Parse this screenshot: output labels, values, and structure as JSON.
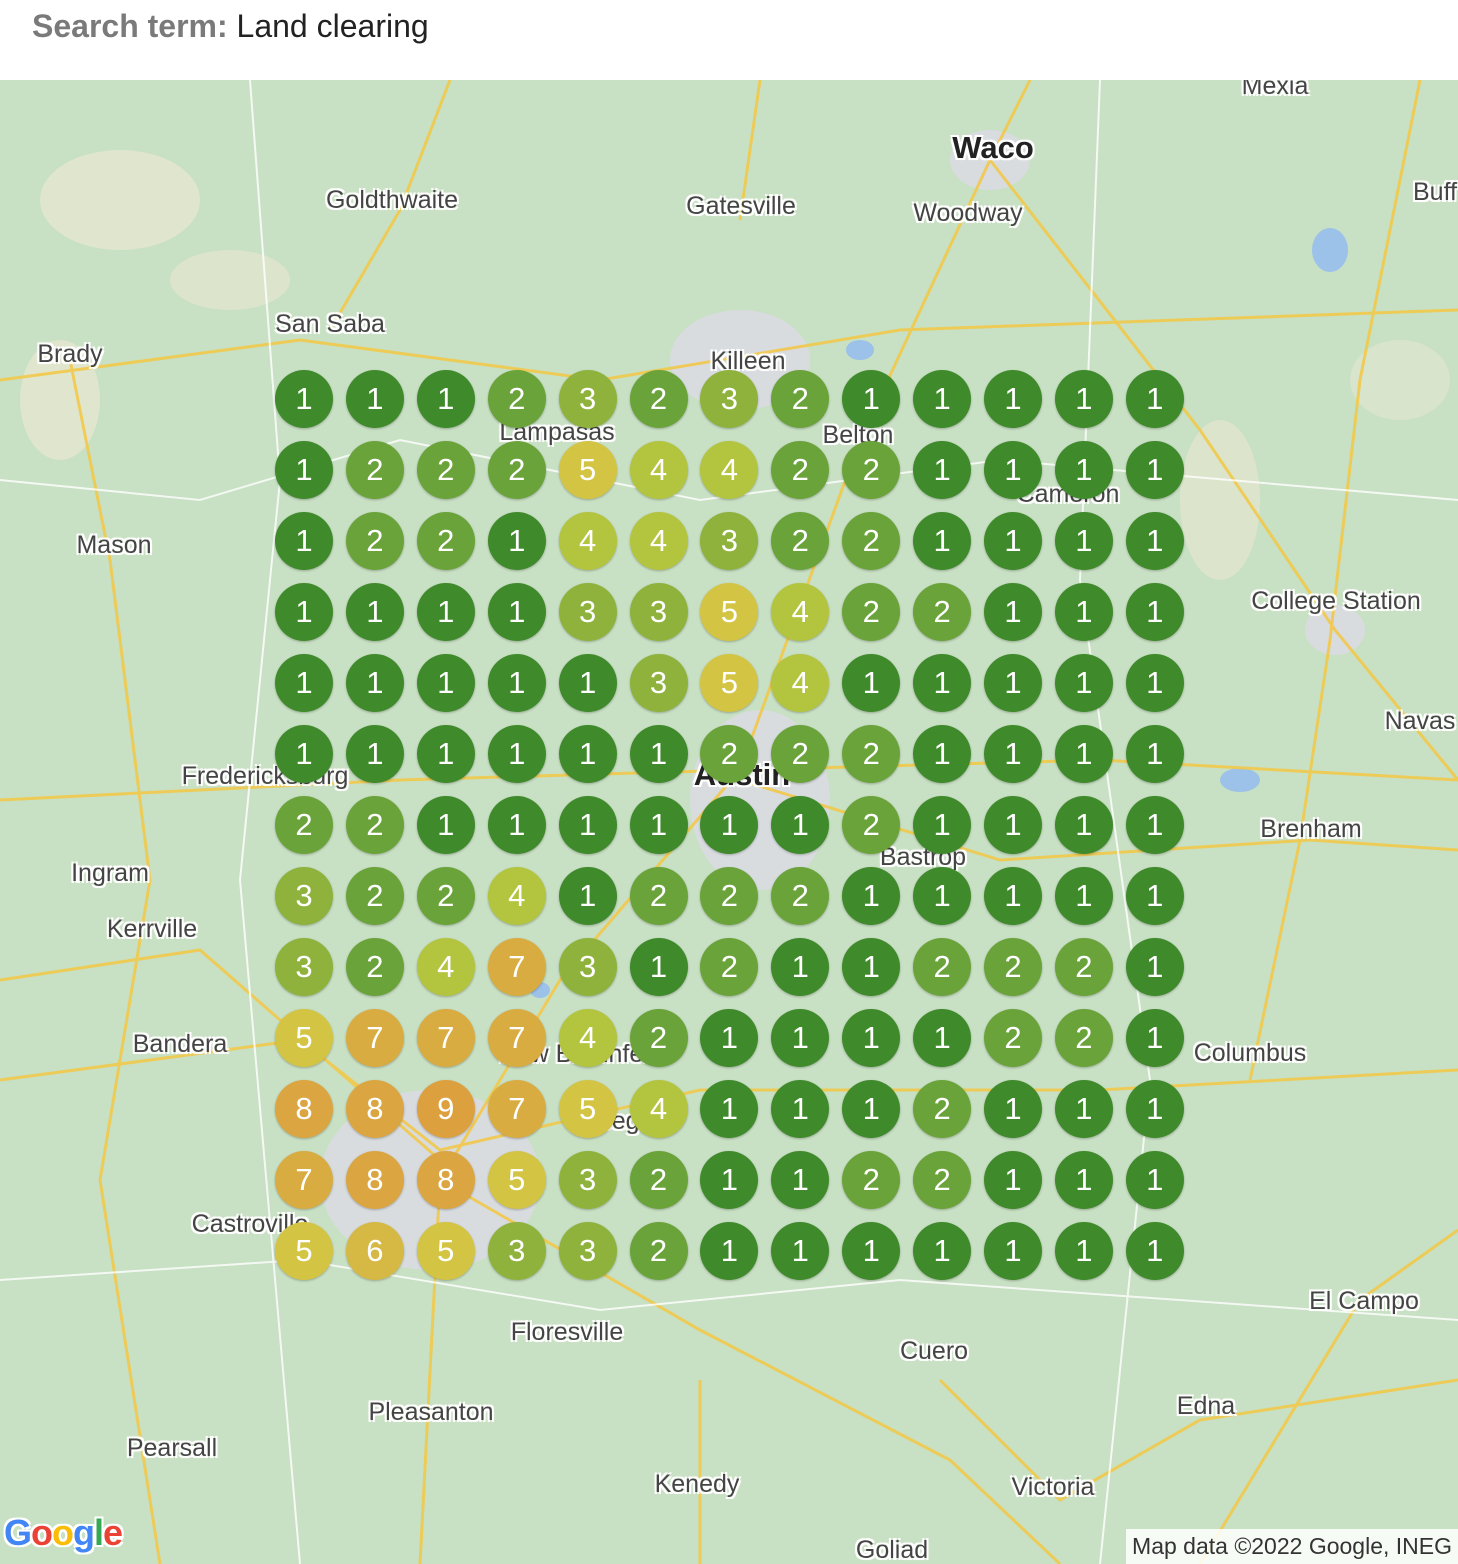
{
  "search": {
    "label": "Search term:",
    "value": "Land clearing"
  },
  "map": {
    "cities": [
      {
        "name": "Waco",
        "big": true
      },
      {
        "name": "Mexia"
      },
      {
        "name": "Goldthwaite"
      },
      {
        "name": "Gatesville"
      },
      {
        "name": "Woodway"
      },
      {
        "name": "San Saba"
      },
      {
        "name": "Brady"
      },
      {
        "name": "Killeen"
      },
      {
        "name": "Lampasas"
      },
      {
        "name": "Belton"
      },
      {
        "name": "Cameron"
      },
      {
        "name": "Mason"
      },
      {
        "name": "College Station"
      },
      {
        "name": "Austin",
        "big": true
      },
      {
        "name": "Fredericksburg"
      },
      {
        "name": "Bastrop"
      },
      {
        "name": "Brenham"
      },
      {
        "name": "Ingram"
      },
      {
        "name": "Kerrville"
      },
      {
        "name": "Bandera"
      },
      {
        "name": "New Braunfels"
      },
      {
        "name": "Columbus"
      },
      {
        "name": "Seguin"
      },
      {
        "name": "Castroville"
      },
      {
        "name": "El Campo"
      },
      {
        "name": "Floresville"
      },
      {
        "name": "Cuero"
      },
      {
        "name": "Pleasanton"
      },
      {
        "name": "Edna"
      },
      {
        "name": "Pearsall"
      },
      {
        "name": "Kenedy"
      },
      {
        "name": "Victoria"
      },
      {
        "name": "Goliad"
      },
      {
        "name": "Navas"
      },
      {
        "name": "Buff"
      }
    ],
    "rank_grid": [
      [
        1,
        1,
        1,
        2,
        3,
        2,
        3,
        2,
        1,
        1,
        1,
        1,
        1
      ],
      [
        1,
        2,
        2,
        2,
        5,
        4,
        4,
        2,
        2,
        1,
        1,
        1,
        1
      ],
      [
        1,
        2,
        2,
        1,
        4,
        4,
        3,
        2,
        2,
        1,
        1,
        1,
        1
      ],
      [
        1,
        1,
        1,
        1,
        3,
        3,
        5,
        4,
        2,
        2,
        1,
        1,
        1
      ],
      [
        1,
        1,
        1,
        1,
        1,
        3,
        5,
        4,
        1,
        1,
        1,
        1,
        1
      ],
      [
        1,
        1,
        1,
        1,
        1,
        1,
        2,
        2,
        2,
        1,
        1,
        1,
        1
      ],
      [
        2,
        2,
        1,
        1,
        1,
        1,
        1,
        1,
        2,
        1,
        1,
        1,
        1
      ],
      [
        3,
        2,
        2,
        4,
        1,
        2,
        2,
        2,
        1,
        1,
        1,
        1,
        1
      ],
      [
        3,
        2,
        4,
        7,
        3,
        1,
        2,
        1,
        1,
        2,
        2,
        2,
        1
      ],
      [
        5,
        7,
        7,
        7,
        4,
        2,
        1,
        1,
        1,
        1,
        2,
        2,
        1
      ],
      [
        8,
        8,
        9,
        7,
        5,
        4,
        1,
        1,
        1,
        2,
        1,
        1,
        1
      ],
      [
        7,
        8,
        8,
        5,
        3,
        2,
        1,
        1,
        2,
        2,
        1,
        1,
        1
      ],
      [
        5,
        6,
        5,
        3,
        3,
        2,
        1,
        1,
        1,
        1,
        1,
        1,
        1
      ]
    ],
    "rank_colors": {
      "1": "#3f8a2b",
      "2": "#6aa33a",
      "3": "#8fb23c",
      "4": "#b3c43f",
      "5": "#d4c444",
      "6": "#d6b844",
      "7": "#d9ac42",
      "8": "#dba642",
      "9": "#dca03f"
    },
    "google_logo": "Google",
    "attribution": "Map data ©2022 Google, INEG"
  }
}
